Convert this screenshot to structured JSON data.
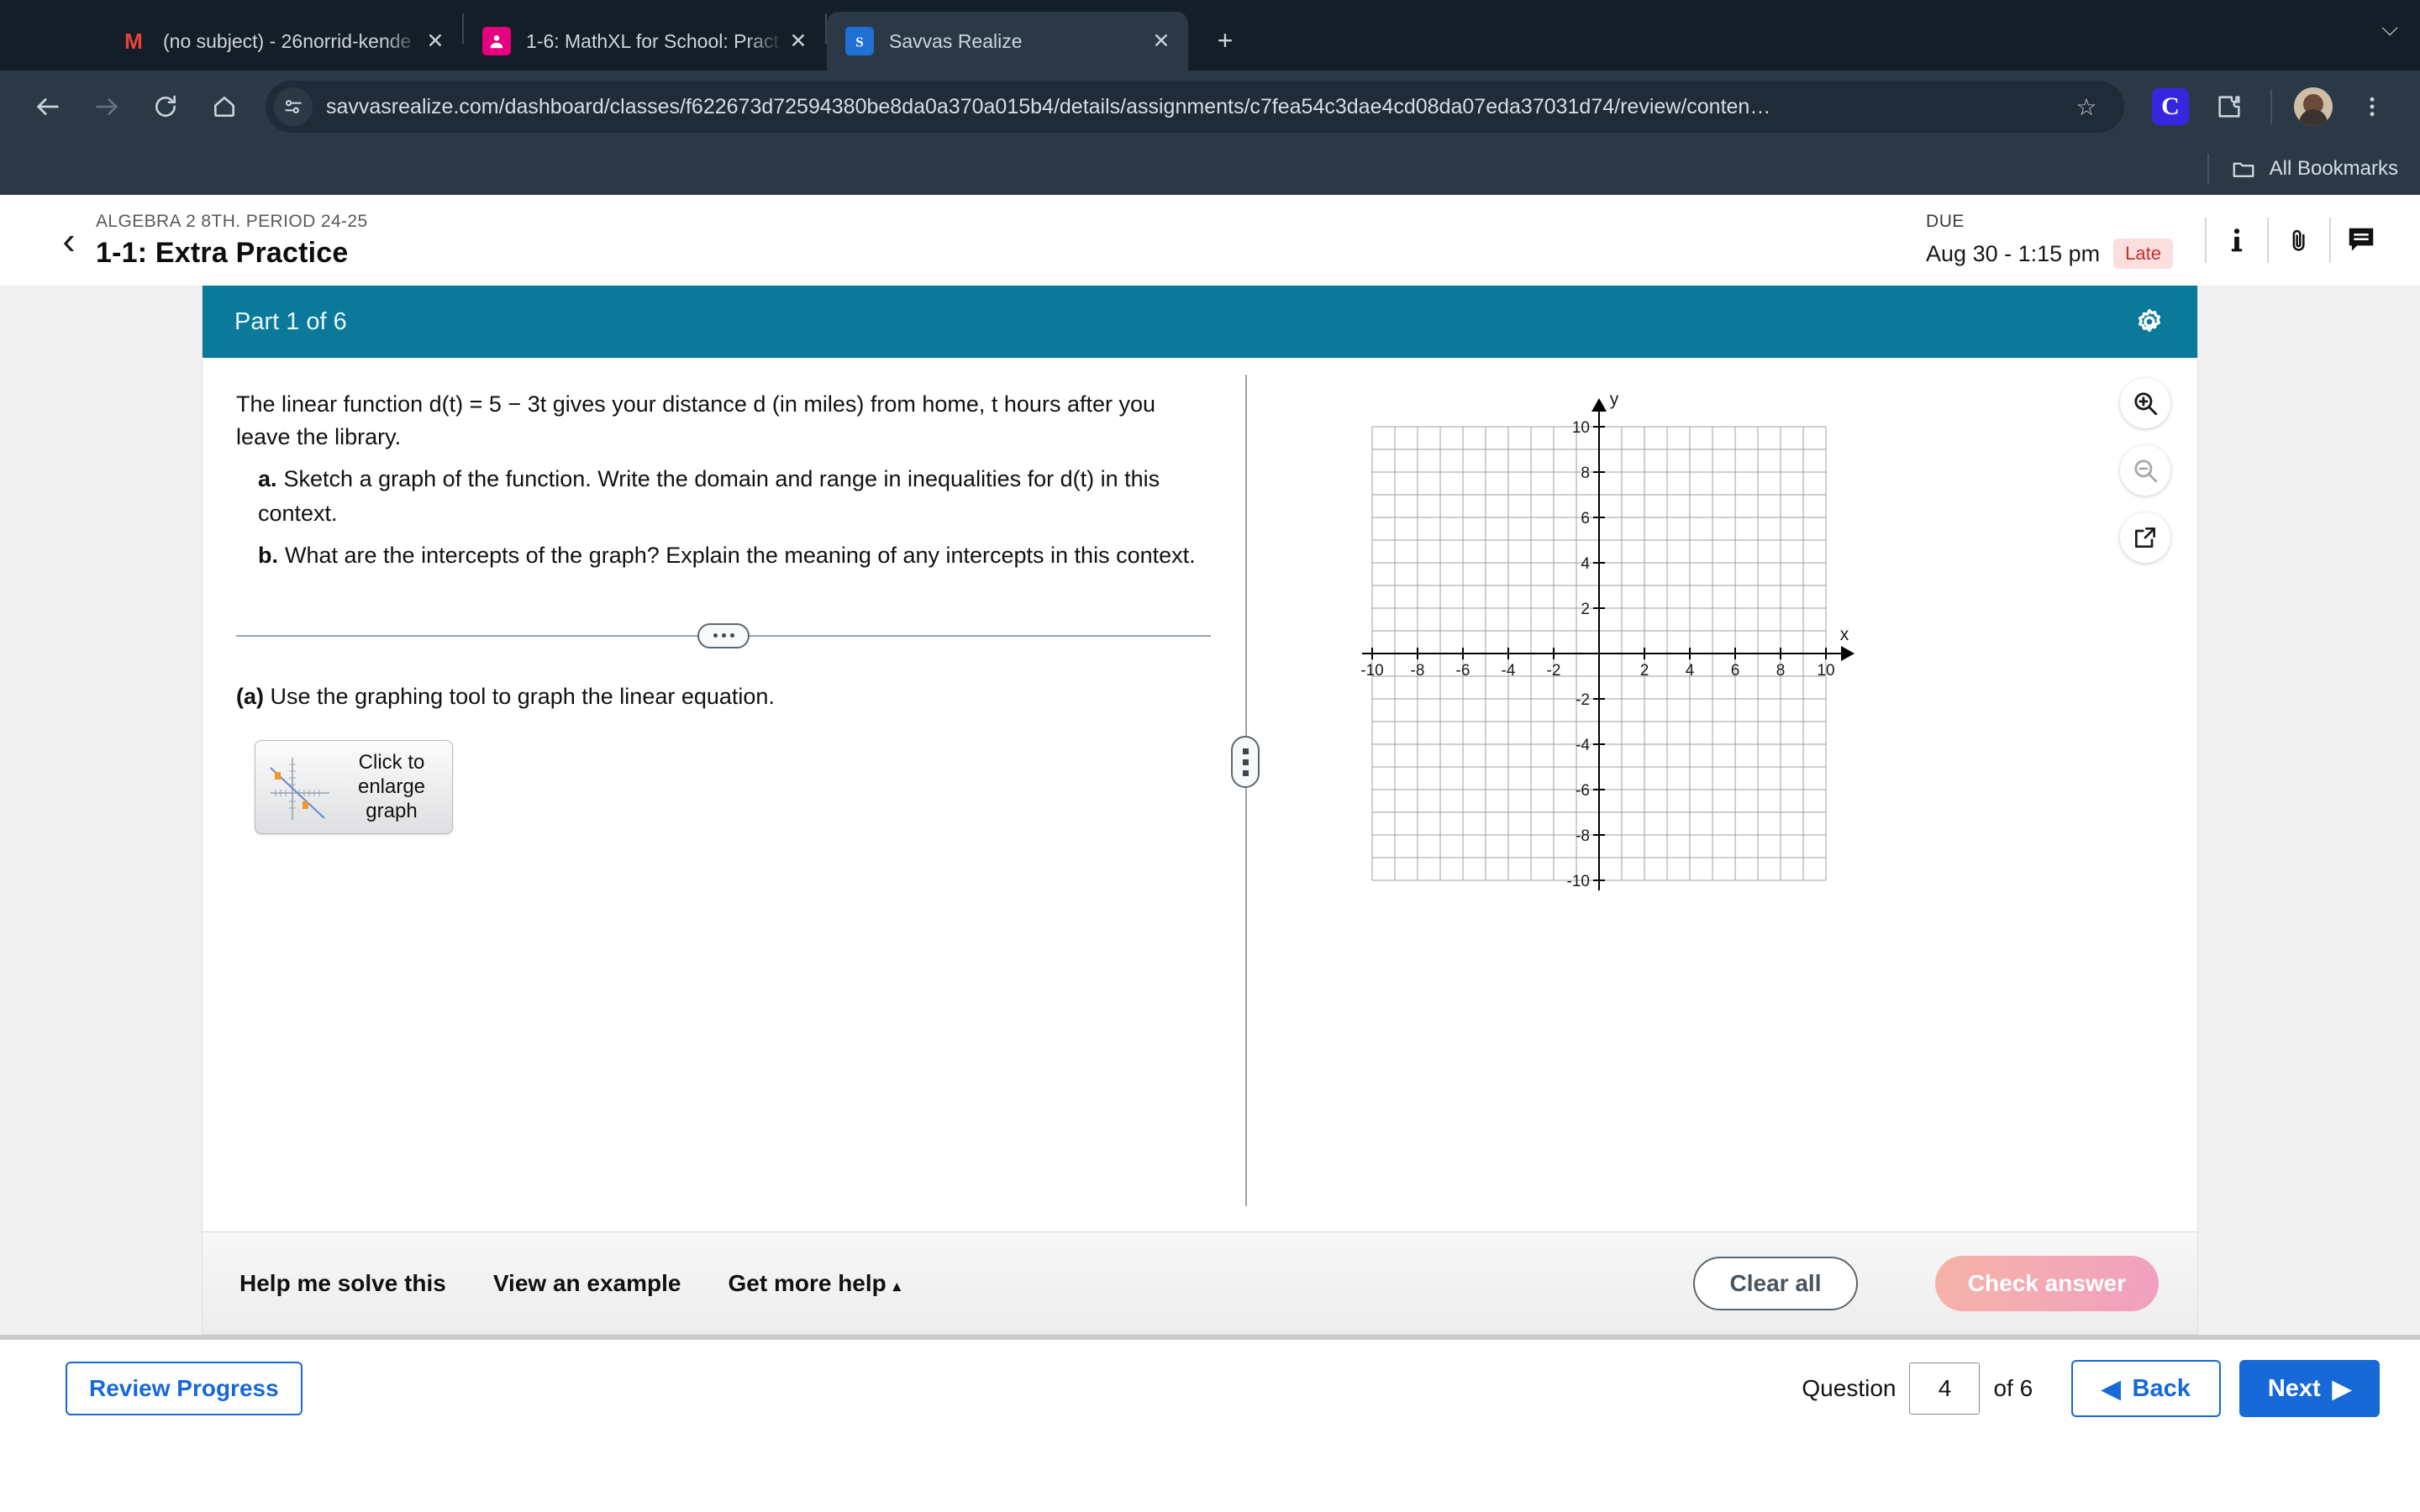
{
  "browser": {
    "tabs": [
      {
        "title": "(no subject) - 26norrid-kende",
        "favicon": "gmail-icon",
        "active": false,
        "close_label": "✕"
      },
      {
        "title": "1-6: MathXL for School: Pract",
        "favicon": "mathxl-icon",
        "active": false,
        "close_label": "✕"
      },
      {
        "title": "Savvas Realize",
        "favicon": "savvas-icon",
        "active": true,
        "close_label": "✕"
      }
    ],
    "new_tab_label": "+",
    "window_caret": "⌵",
    "url": "savvasrealize.com/dashboard/classes/f622673d72594380be8da0a370a015b4/details/assignments/c7fea54c3dae4cd08da07eda37031d74/review/conten…",
    "star_label": "☆",
    "extension_c_label": "C",
    "bookmarks_label": "All Bookmarks"
  },
  "header": {
    "back_chevron": "‹",
    "course": "ALGEBRA 2 8TH. PERIOD 24-25",
    "assignment": "1-1: Extra Practice",
    "due_label": "DUE",
    "due_date": "Aug 30 - 1:15 pm",
    "late_badge": "Late"
  },
  "exercise": {
    "part_label": "Part 1 of 6",
    "question_text": "The linear function d(t) = 5 − 3t gives your distance d (in miles) from home, t hours after you leave the library.",
    "sub_questions": [
      {
        "label": "a.",
        "text": "Sketch a graph of the function. Write the domain and range in inequalities for d(t) in this context."
      },
      {
        "label": "b.",
        "text": "What are the intercepts of the graph? Explain the meaning of any intercepts in this context."
      }
    ],
    "part_a_prefix": "(a)",
    "part_a_text": "Use the graphing tool to graph the linear equation.",
    "enlarge_button_label": "Click to enlarge graph"
  },
  "graph": {
    "x_ticks": [
      "-10",
      "-8",
      "-6",
      "-4",
      "-2",
      "2",
      "4",
      "6",
      "8",
      "10"
    ],
    "y_ticks": [
      "10",
      "8",
      "6",
      "4",
      "2",
      "-2",
      "-4",
      "-6",
      "-8",
      "-10"
    ],
    "x_axis_label": "x",
    "y_axis_label": "y",
    "xlim": [
      -10,
      10
    ],
    "ylim": [
      -10,
      10
    ],
    "grid_step": 1,
    "tick_step": 2
  },
  "footer": {
    "help_links": [
      "Help me solve this",
      "View an example",
      "Get more help"
    ],
    "get_more_help_caret": "▴",
    "clear_all": "Clear all",
    "check_answer": "Check answer"
  },
  "bottom_nav": {
    "review_progress": "Review Progress",
    "question_label": "Question",
    "question_value": "4",
    "of_label": "of 6",
    "back_label": "Back",
    "back_caret": "◀",
    "next_label": "Next",
    "next_caret": "▶"
  },
  "colors": {
    "teal": "#0b7a9a",
    "blue": "#1669d6",
    "late_red": "#c53030",
    "chrome_dark": "#2b3947"
  }
}
